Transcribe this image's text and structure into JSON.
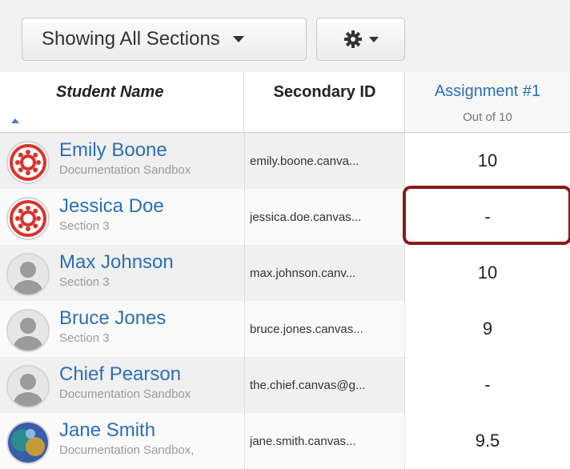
{
  "toolbar": {
    "sections_label": "Showing All Sections",
    "settings_icon": "gear-icon"
  },
  "header": {
    "student_name": "Student Name",
    "secondary_id": "Secondary ID",
    "assignment_title": "Assignment #1",
    "assignment_sub": "Out of 10"
  },
  "rows": [
    {
      "name": "Emily Boone",
      "section": "Documentation Sandbox",
      "secondary_id": "emily.boone.canva...",
      "grade": "10",
      "avatar": "canvas-logo"
    },
    {
      "name": "Jessica Doe",
      "section": "Section 3",
      "secondary_id": "jessica.doe.canvas...",
      "grade": "-",
      "avatar": "canvas-logo"
    },
    {
      "name": "Max Johnson",
      "section": "Section 3",
      "secondary_id": "max.johnson.canv...",
      "grade": "10",
      "avatar": "default-user"
    },
    {
      "name": "Bruce Jones",
      "section": "Section 3",
      "secondary_id": "bruce.jones.canvas...",
      "grade": "9",
      "avatar": "default-user"
    },
    {
      "name": "Chief Pearson",
      "section": "Documentation Sandbox",
      "secondary_id": "the.chief.canvas@g...",
      "grade": "-",
      "avatar": "default-user"
    },
    {
      "name": "Jane Smith",
      "section": "Documentation Sandbox,",
      "secondary_id": "jane.smith.canvas...",
      "grade": "9.5",
      "avatar": "photo"
    }
  ],
  "colors": {
    "accent": "#2b6fb5",
    "highlight": "#8b1a1a",
    "canvas_red": "#d8342d"
  }
}
